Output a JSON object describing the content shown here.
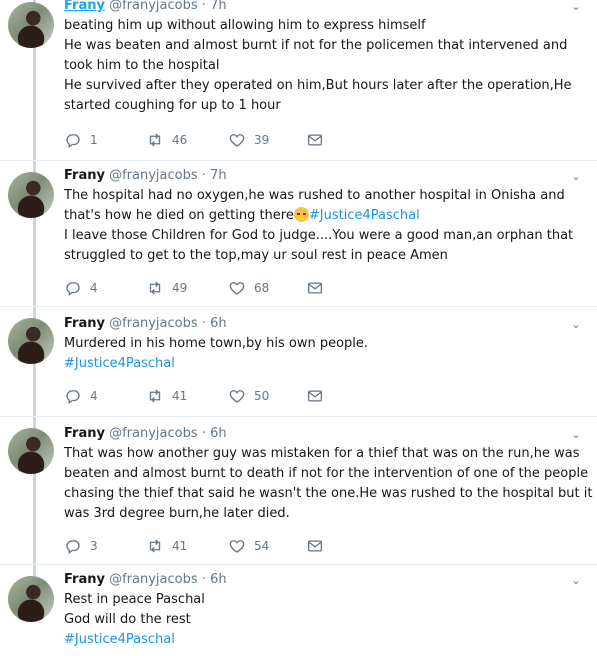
{
  "tweets": [
    {
      "name": "Frany",
      "handle": "@franyjacobs",
      "dot": "·",
      "time": "7h",
      "caret": "⌄",
      "lines": [
        "beating him up without allowing him to express himself",
        "He was beaten and almost burnt if not for the policemen that intervened and",
        "took him to the hospital",
        "He survived after they operated on him,But hours later after the operation,He",
        "started coughing for up to 1 hour"
      ],
      "replies": "1",
      "retweets": "46",
      "likes": "39"
    },
    {
      "name": "Frany",
      "handle": "@franyjacobs",
      "dot": "·",
      "time": "7h",
      "caret": "⌄",
      "line1": "The hospital had no oxygen,he was rushed to another hospital in Onisha and",
      "line2_text": "that's how he died on getting there",
      "line2_hashtag": "#Justice4Paschal",
      "line3": "I leave those Children for God to judge....You were a good man,an orphan that",
      "line4": "struggled to get to the top,may ur soul rest in peace Amen",
      "replies": "4",
      "retweets": "49",
      "likes": "68"
    },
    {
      "name": "Frany",
      "handle": "@franyjacobs",
      "dot": "·",
      "time": "6h",
      "caret": "⌄",
      "line1": "Murdered in his home town,by his own people.",
      "hashtag": "#Justice4Paschal",
      "replies": "4",
      "retweets": "41",
      "likes": "50"
    },
    {
      "name": "Frany",
      "handle": "@franyjacobs",
      "dot": "·",
      "time": "6h",
      "caret": "⌄",
      "lines": [
        "That was how another guy was mistaken for a thief that was on the run,he was",
        "beaten and almost burnt to death if not for the intervention of one of the people",
        "chasing the thief that said he wasn't the one.He was rushed to the hospital but it",
        "was 3rd degree burn,he later died."
      ],
      "replies": "3",
      "retweets": "41",
      "likes": "54"
    },
    {
      "name": "Frany",
      "handle": "@franyjacobs",
      "dot": "·",
      "time": "6h",
      "caret": "⌄",
      "line1": "Rest in peace Paschal",
      "line2": "God will do the rest",
      "hashtag": "#Justice4Paschal"
    }
  ],
  "icons": {
    "reply": "reply-icon",
    "retweet": "retweet-icon",
    "like": "heart-icon",
    "dm": "mail-icon"
  },
  "colors": {
    "link": "#1b95e0",
    "muted": "#657786",
    "thread": "#ccd6dd"
  }
}
